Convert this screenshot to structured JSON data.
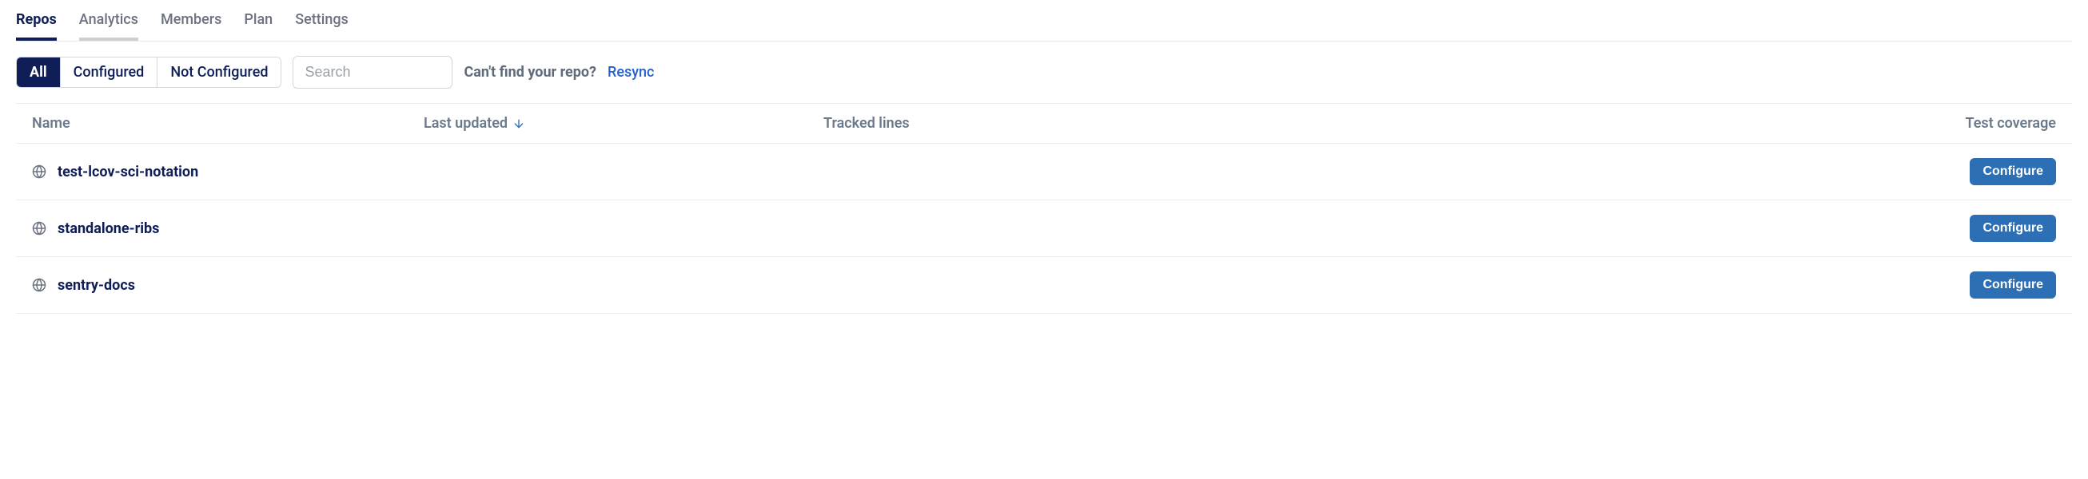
{
  "tabs": {
    "repos": "Repos",
    "analytics": "Analytics",
    "members": "Members",
    "plan": "Plan",
    "settings": "Settings"
  },
  "filters": {
    "all": "All",
    "configured": "Configured",
    "not_configured": "Not Configured"
  },
  "search": {
    "placeholder": "Search"
  },
  "hint": {
    "text": "Can't find your repo?",
    "resync": "Resync"
  },
  "columns": {
    "name": "Name",
    "last_updated": "Last updated",
    "tracked_lines": "Tracked lines",
    "test_coverage": "Test coverage"
  },
  "rows": [
    {
      "name": "test-lcov-sci-notation",
      "action": "Configure"
    },
    {
      "name": "standalone-ribs",
      "action": "Configure"
    },
    {
      "name": "sentry-docs",
      "action": "Configure"
    }
  ]
}
